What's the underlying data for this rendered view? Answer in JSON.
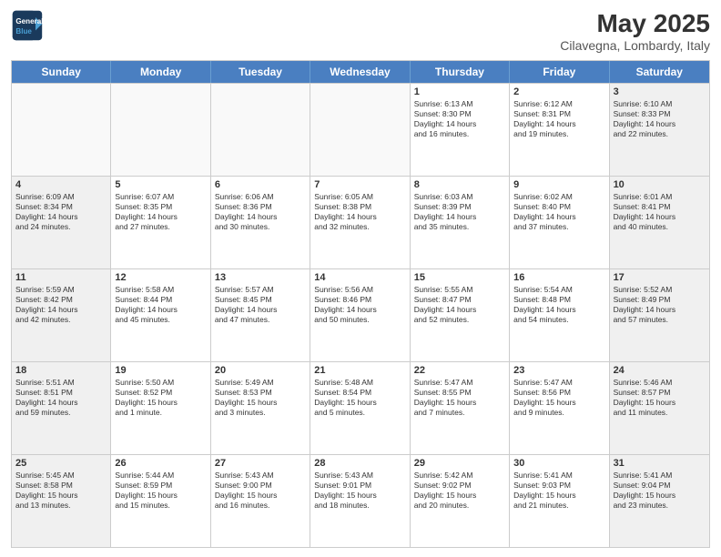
{
  "header": {
    "logo": {
      "line1": "General",
      "line2": "Blue"
    },
    "month": "May 2025",
    "location": "Cilavegna, Lombardy, Italy"
  },
  "weekdays": [
    "Sunday",
    "Monday",
    "Tuesday",
    "Wednesday",
    "Thursday",
    "Friday",
    "Saturday"
  ],
  "rows": [
    [
      {
        "day": "",
        "empty": true
      },
      {
        "day": "",
        "empty": true
      },
      {
        "day": "",
        "empty": true
      },
      {
        "day": "",
        "empty": true
      },
      {
        "day": "1",
        "lines": [
          "Sunrise: 6:13 AM",
          "Sunset: 8:30 PM",
          "Daylight: 14 hours",
          "and 16 minutes."
        ]
      },
      {
        "day": "2",
        "lines": [
          "Sunrise: 6:12 AM",
          "Sunset: 8:31 PM",
          "Daylight: 14 hours",
          "and 19 minutes."
        ]
      },
      {
        "day": "3",
        "lines": [
          "Sunrise: 6:10 AM",
          "Sunset: 8:33 PM",
          "Daylight: 14 hours",
          "and 22 minutes."
        ]
      }
    ],
    [
      {
        "day": "4",
        "lines": [
          "Sunrise: 6:09 AM",
          "Sunset: 8:34 PM",
          "Daylight: 14 hours",
          "and 24 minutes."
        ]
      },
      {
        "day": "5",
        "lines": [
          "Sunrise: 6:07 AM",
          "Sunset: 8:35 PM",
          "Daylight: 14 hours",
          "and 27 minutes."
        ]
      },
      {
        "day": "6",
        "lines": [
          "Sunrise: 6:06 AM",
          "Sunset: 8:36 PM",
          "Daylight: 14 hours",
          "and 30 minutes."
        ]
      },
      {
        "day": "7",
        "lines": [
          "Sunrise: 6:05 AM",
          "Sunset: 8:38 PM",
          "Daylight: 14 hours",
          "and 32 minutes."
        ]
      },
      {
        "day": "8",
        "lines": [
          "Sunrise: 6:03 AM",
          "Sunset: 8:39 PM",
          "Daylight: 14 hours",
          "and 35 minutes."
        ]
      },
      {
        "day": "9",
        "lines": [
          "Sunrise: 6:02 AM",
          "Sunset: 8:40 PM",
          "Daylight: 14 hours",
          "and 37 minutes."
        ]
      },
      {
        "day": "10",
        "lines": [
          "Sunrise: 6:01 AM",
          "Sunset: 8:41 PM",
          "Daylight: 14 hours",
          "and 40 minutes."
        ]
      }
    ],
    [
      {
        "day": "11",
        "lines": [
          "Sunrise: 5:59 AM",
          "Sunset: 8:42 PM",
          "Daylight: 14 hours",
          "and 42 minutes."
        ]
      },
      {
        "day": "12",
        "lines": [
          "Sunrise: 5:58 AM",
          "Sunset: 8:44 PM",
          "Daylight: 14 hours",
          "and 45 minutes."
        ]
      },
      {
        "day": "13",
        "lines": [
          "Sunrise: 5:57 AM",
          "Sunset: 8:45 PM",
          "Daylight: 14 hours",
          "and 47 minutes."
        ]
      },
      {
        "day": "14",
        "lines": [
          "Sunrise: 5:56 AM",
          "Sunset: 8:46 PM",
          "Daylight: 14 hours",
          "and 50 minutes."
        ]
      },
      {
        "day": "15",
        "lines": [
          "Sunrise: 5:55 AM",
          "Sunset: 8:47 PM",
          "Daylight: 14 hours",
          "and 52 minutes."
        ]
      },
      {
        "day": "16",
        "lines": [
          "Sunrise: 5:54 AM",
          "Sunset: 8:48 PM",
          "Daylight: 14 hours",
          "and 54 minutes."
        ]
      },
      {
        "day": "17",
        "lines": [
          "Sunrise: 5:52 AM",
          "Sunset: 8:49 PM",
          "Daylight: 14 hours",
          "and 57 minutes."
        ]
      }
    ],
    [
      {
        "day": "18",
        "lines": [
          "Sunrise: 5:51 AM",
          "Sunset: 8:51 PM",
          "Daylight: 14 hours",
          "and 59 minutes."
        ]
      },
      {
        "day": "19",
        "lines": [
          "Sunrise: 5:50 AM",
          "Sunset: 8:52 PM",
          "Daylight: 15 hours",
          "and 1 minute."
        ]
      },
      {
        "day": "20",
        "lines": [
          "Sunrise: 5:49 AM",
          "Sunset: 8:53 PM",
          "Daylight: 15 hours",
          "and 3 minutes."
        ]
      },
      {
        "day": "21",
        "lines": [
          "Sunrise: 5:48 AM",
          "Sunset: 8:54 PM",
          "Daylight: 15 hours",
          "and 5 minutes."
        ]
      },
      {
        "day": "22",
        "lines": [
          "Sunrise: 5:47 AM",
          "Sunset: 8:55 PM",
          "Daylight: 15 hours",
          "and 7 minutes."
        ]
      },
      {
        "day": "23",
        "lines": [
          "Sunrise: 5:47 AM",
          "Sunset: 8:56 PM",
          "Daylight: 15 hours",
          "and 9 minutes."
        ]
      },
      {
        "day": "24",
        "lines": [
          "Sunrise: 5:46 AM",
          "Sunset: 8:57 PM",
          "Daylight: 15 hours",
          "and 11 minutes."
        ]
      }
    ],
    [
      {
        "day": "25",
        "lines": [
          "Sunrise: 5:45 AM",
          "Sunset: 8:58 PM",
          "Daylight: 15 hours",
          "and 13 minutes."
        ]
      },
      {
        "day": "26",
        "lines": [
          "Sunrise: 5:44 AM",
          "Sunset: 8:59 PM",
          "Daylight: 15 hours",
          "and 15 minutes."
        ]
      },
      {
        "day": "27",
        "lines": [
          "Sunrise: 5:43 AM",
          "Sunset: 9:00 PM",
          "Daylight: 15 hours",
          "and 16 minutes."
        ]
      },
      {
        "day": "28",
        "lines": [
          "Sunrise: 5:43 AM",
          "Sunset: 9:01 PM",
          "Daylight: 15 hours",
          "and 18 minutes."
        ]
      },
      {
        "day": "29",
        "lines": [
          "Sunrise: 5:42 AM",
          "Sunset: 9:02 PM",
          "Daylight: 15 hours",
          "and 20 minutes."
        ]
      },
      {
        "day": "30",
        "lines": [
          "Sunrise: 5:41 AM",
          "Sunset: 9:03 PM",
          "Daylight: 15 hours",
          "and 21 minutes."
        ]
      },
      {
        "day": "31",
        "lines": [
          "Sunrise: 5:41 AM",
          "Sunset: 9:04 PM",
          "Daylight: 15 hours",
          "and 23 minutes."
        ]
      }
    ]
  ]
}
